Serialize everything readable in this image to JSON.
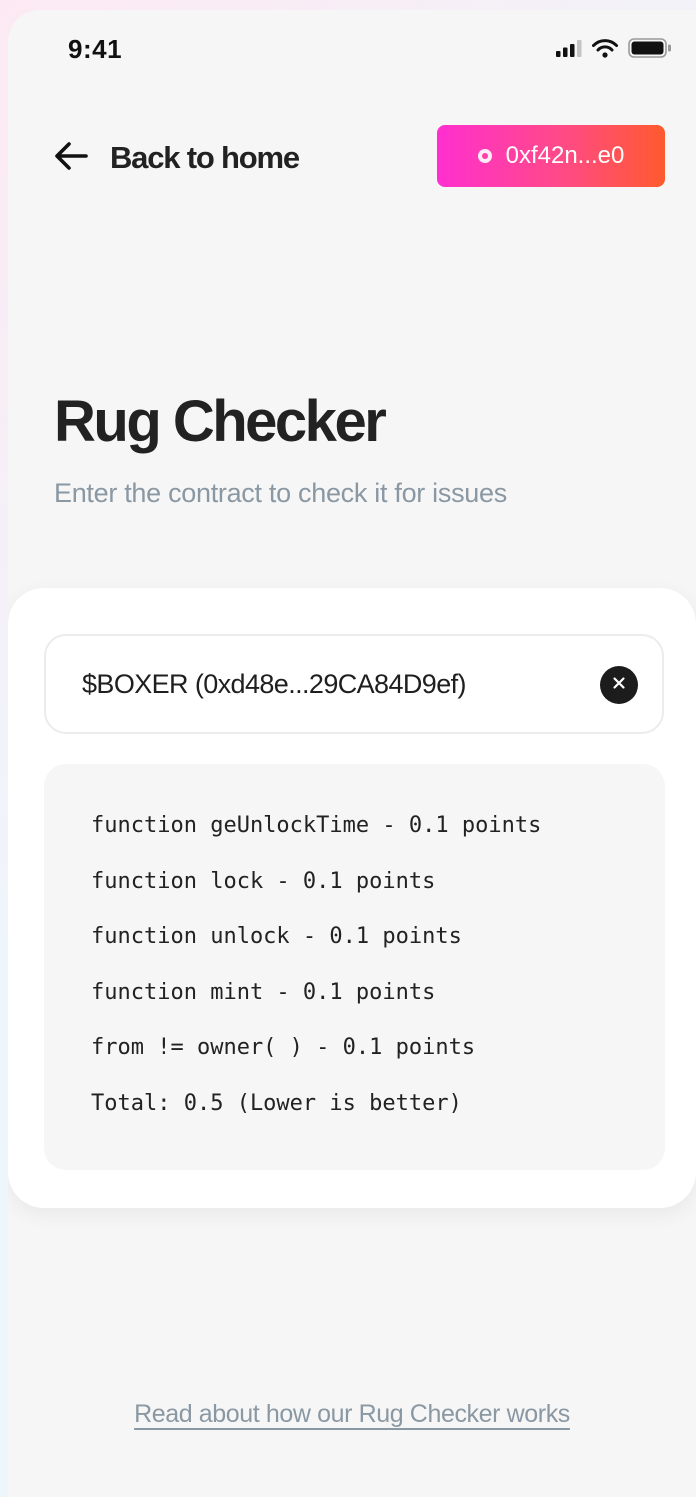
{
  "status_bar": {
    "time": "9:41",
    "icons": [
      "signal-icon",
      "wifi-icon",
      "battery-icon"
    ]
  },
  "header": {
    "back_label": "Back to home",
    "wallet_address": "0xf42n...e0",
    "wallet_colors": [
      "#ff2fd0",
      "#ff5a2e"
    ]
  },
  "page": {
    "title": "Rug Checker",
    "subtitle": "Enter the contract to check it for issues"
  },
  "contract_input": {
    "value": "$BOXER (0xd48e...29CA84D9ef)"
  },
  "results": {
    "lines": [
      "function geUnlockTime - 0.1 points",
      "function lock - 0.1 points",
      "function unlock - 0.1 points",
      "function mint - 0.1 points",
      "from != owner( ) - 0.1 points",
      "Total: 0.5 (Lower is better)"
    ]
  },
  "footer": {
    "link_label": "Read about how our Rug Checker works"
  }
}
